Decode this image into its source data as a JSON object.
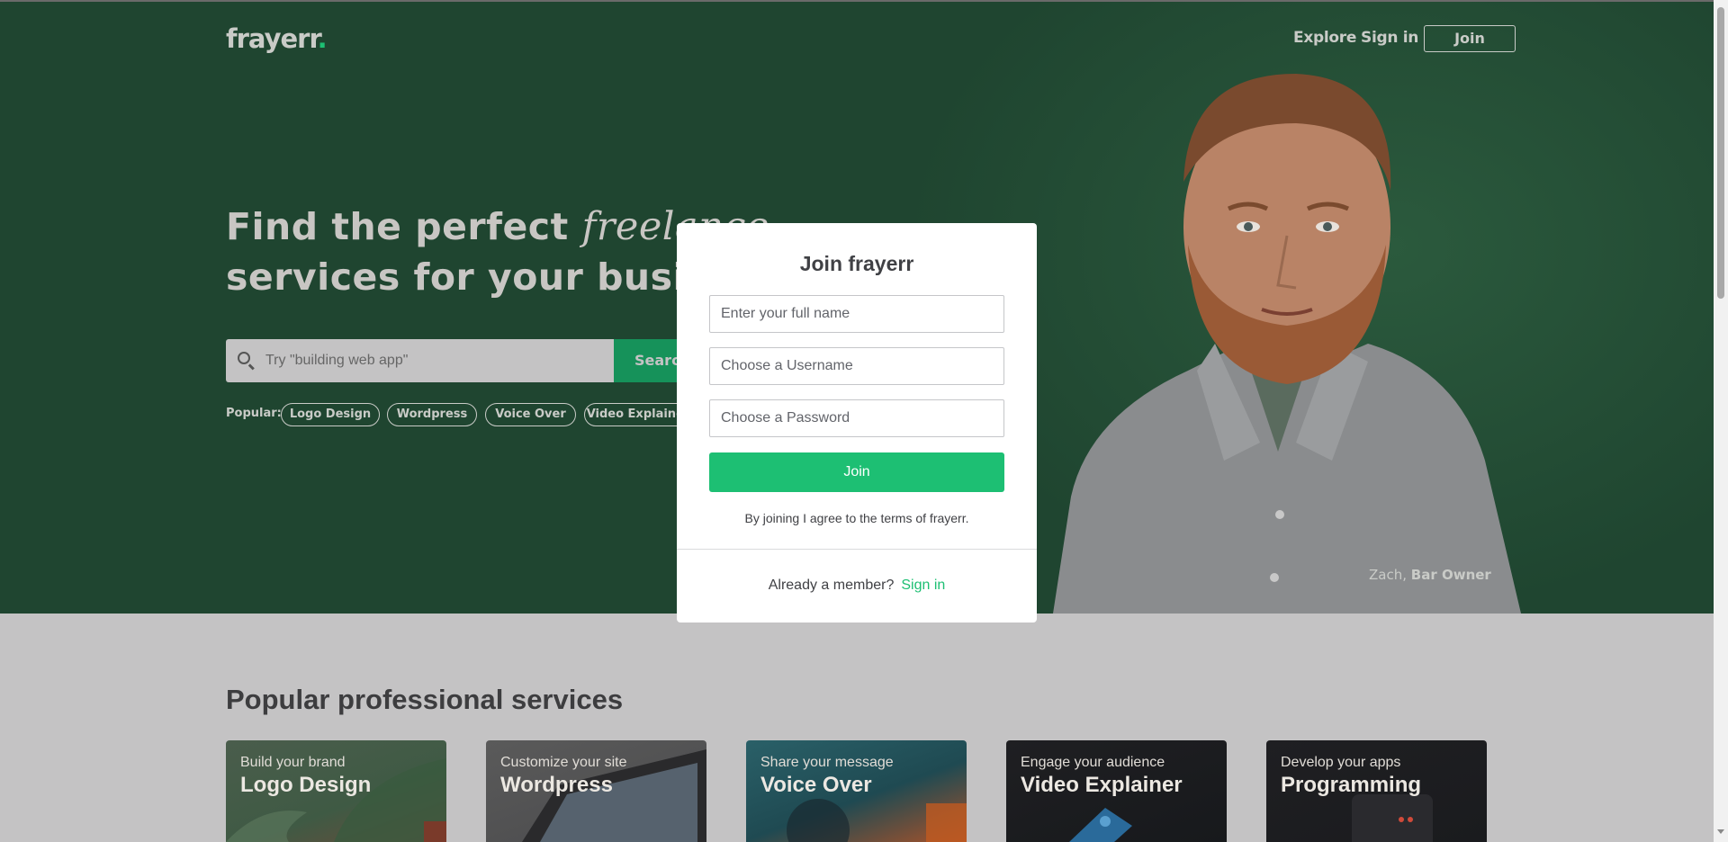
{
  "header": {
    "logo_text": "frayerr",
    "logo_dot": ".",
    "nav": {
      "explore": "Explore",
      "sign_in": "Sign in",
      "join": "Join"
    }
  },
  "hero": {
    "headline_part1": "Find the perfect ",
    "headline_italic": "freelance",
    "headline_line2": "services for your business",
    "search": {
      "placeholder": "Try \"building web app\"",
      "button_label": "Search"
    },
    "popular_label": "Popular:",
    "popular_tags": [
      "Logo Design",
      "Wordpress",
      "Voice Over",
      "Video Explainer"
    ],
    "caption_name": "Zach,",
    "caption_role": "Bar Owner"
  },
  "modal": {
    "title": "Join frayerr",
    "fullname_placeholder": "Enter your full name",
    "username_placeholder": "Choose a Username",
    "password_placeholder": "Choose a Password",
    "join_button": "Join",
    "terms": "By joining I agree to the terms of frayerr.",
    "member_text": "Already a member?",
    "sign_in_link": "Sign in"
  },
  "services": {
    "title": "Popular professional services",
    "cards": [
      {
        "subtitle": "Build your brand",
        "title": "Logo Design"
      },
      {
        "subtitle": "Customize your site",
        "title": "Wordpress"
      },
      {
        "subtitle": "Share your message",
        "title": "Voice Over"
      },
      {
        "subtitle": "Engage your audience",
        "title": "Video Explainer"
      },
      {
        "subtitle": "Develop your apps",
        "title": "Programming"
      }
    ]
  },
  "colors": {
    "hero_bg": "#1f4530",
    "accent": "#1dbf73",
    "overlay_bg": "#c4c3c4"
  }
}
